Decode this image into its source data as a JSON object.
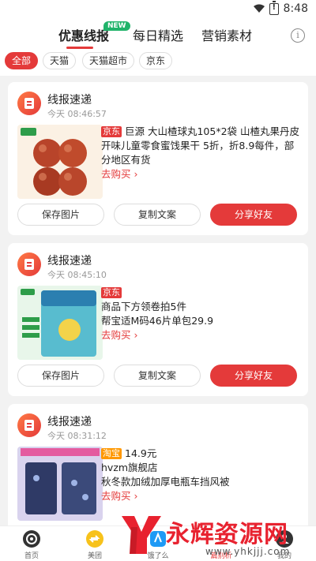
{
  "status_bar": {
    "time": "8:48"
  },
  "header": {
    "tabs": [
      {
        "label": "优惠线报",
        "badge": "NEW"
      },
      {
        "label": "每日精选"
      },
      {
        "label": "营销素材"
      }
    ],
    "info_icon": "info-icon",
    "filters": [
      "全部",
      "天猫",
      "天猫超市",
      "京东"
    ]
  },
  "feed": {
    "cards": [
      {
        "title": "线报速递",
        "time": "今天 08:46:57",
        "shop_tag": "京东",
        "text": "巨源 大山楂球丸105*2袋 山楂丸果丹皮开味儿童零食蜜饯果干 5折，折8.9每件，部分地区有货",
        "buy_label": "去购买",
        "buttons": [
          "保存图片",
          "复制文案",
          "分享好友"
        ]
      },
      {
        "title": "线报速递",
        "time": "今天 08:45:10",
        "shop_tag": "京东",
        "text_line1": "商品下方领卷拍5件",
        "text_line2": "帮宝适M码46片单包29.9",
        "buy_label": "去购买",
        "buttons": [
          "保存图片",
          "复制文案",
          "分享好友"
        ]
      },
      {
        "title": "线报速递",
        "time": "今天 08:31:12",
        "shop_tag": "淘宝",
        "text_line1": "14.9元",
        "text_line2": "hvzm旗舰店",
        "text_line3": "秋冬款加绒加厚电瓶车挡风被",
        "buy_label": "去购买"
      }
    ]
  },
  "bottom_nav": [
    {
      "label": "首页",
      "icon": "home-swirl-icon"
    },
    {
      "label": "美团",
      "icon": "meituan-icon"
    },
    {
      "label": "饿了么",
      "icon": "eleme-icon"
    },
    {
      "label": "篇别析",
      "icon": "list-icon"
    },
    {
      "label": "我的",
      "icon": "profile-icon"
    }
  ],
  "watermark": {
    "text": "永辉资源网",
    "url": "www.yhkjjj.com"
  },
  "colors": {
    "accent": "#e43a3a",
    "badge_green": "#20b36a",
    "taobao_orange": "#ff9800"
  }
}
